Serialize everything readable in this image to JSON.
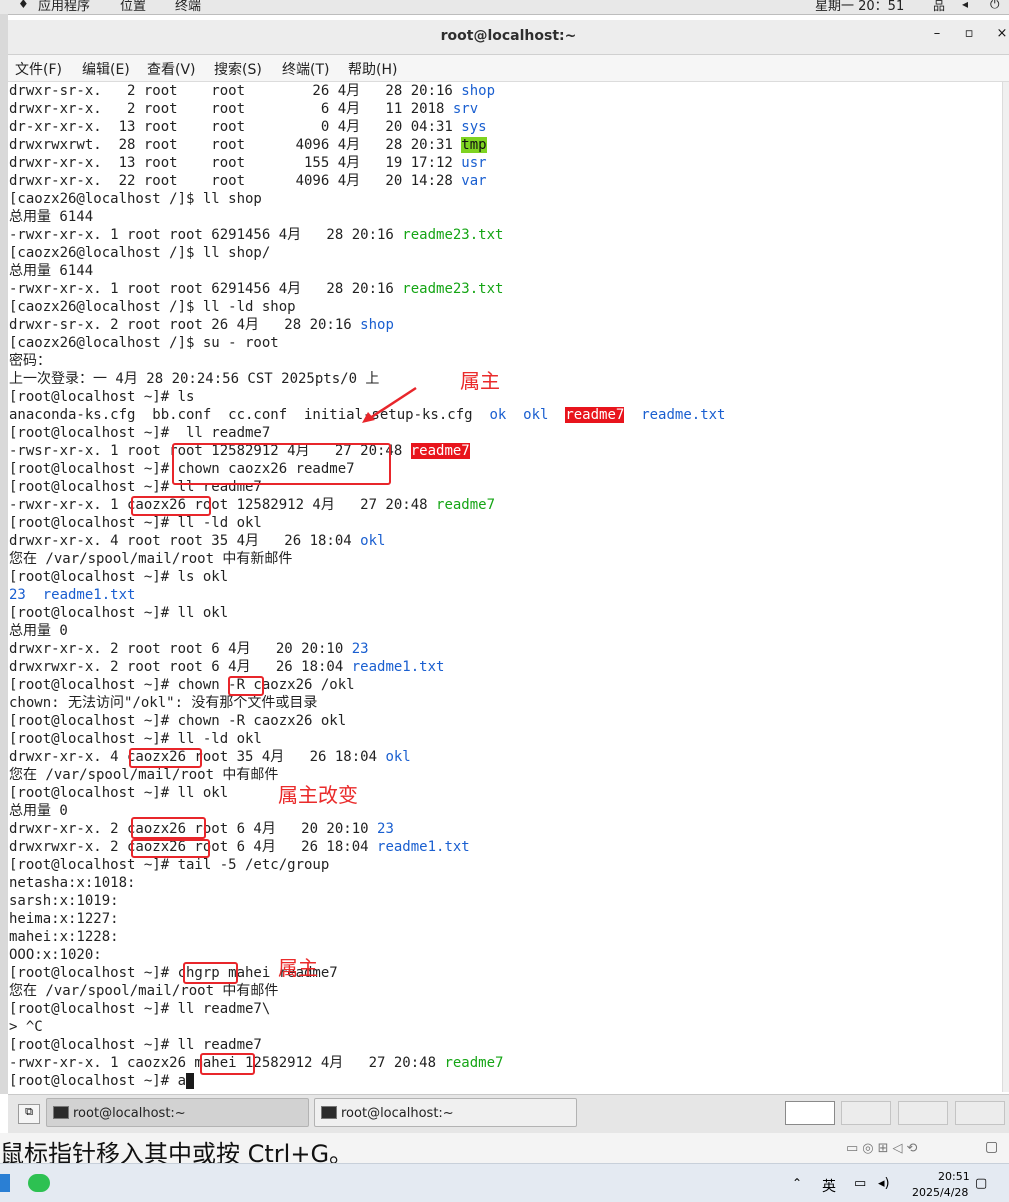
{
  "top_bar": {
    "apps": "应用程序",
    "places": "位置",
    "terminal": "终端",
    "clock": "星期一 20：51"
  },
  "window": {
    "title": "root@localhost:~",
    "minimize": "–",
    "maximize": "▫",
    "close": "×"
  },
  "menu": [
    "文件(F)",
    "编辑(E)",
    "查看(V)",
    "搜索(S)",
    "终端(T)",
    "帮助(H)"
  ],
  "terminal_lines": [
    [
      {
        "t": "drwxr-sr-x.   2 root    root        26 4月   28 20:16 "
      },
      {
        "t": "shop",
        "c": "blue"
      }
    ],
    [
      {
        "t": "drwxr-xr-x.   2 root    root         6 4月   11 2018 "
      },
      {
        "t": "srv",
        "c": "blue"
      }
    ],
    [
      {
        "t": "dr-xr-xr-x.  13 root    root         0 4月   20 04:31 "
      },
      {
        "t": "sys",
        "c": "blue"
      }
    ],
    [
      {
        "t": "drwxrwxrwt.  28 root    root      4096 4月   28 20:31 "
      },
      {
        "t": "tmp",
        "c": "hl-green"
      }
    ],
    [
      {
        "t": "drwxr-xr-x.  13 root    root       155 4月   19 17:12 "
      },
      {
        "t": "usr",
        "c": "blue"
      }
    ],
    [
      {
        "t": "drwxr-xr-x.  22 root    root      4096 4月   20 14:28 "
      },
      {
        "t": "var",
        "c": "blue"
      }
    ],
    [
      {
        "t": "[caozx26@localhost /]$ ll shop"
      }
    ],
    [
      {
        "t": "总用量 6144"
      }
    ],
    [
      {
        "t": "-rwxr-xr-x. 1 root root 6291456 4月   28 20:16 "
      },
      {
        "t": "readme23.txt",
        "c": "green"
      }
    ],
    [
      {
        "t": "[caozx26@localhost /]$ ll shop/"
      }
    ],
    [
      {
        "t": "总用量 6144"
      }
    ],
    [
      {
        "t": "-rwxr-xr-x. 1 root root 6291456 4月   28 20:16 "
      },
      {
        "t": "readme23.txt",
        "c": "green"
      }
    ],
    [
      {
        "t": "[caozx26@localhost /]$ ll -ld shop"
      }
    ],
    [
      {
        "t": "drwxr-sr-x. 2 root root 26 4月   28 20:16 "
      },
      {
        "t": "shop",
        "c": "blue"
      }
    ],
    [
      {
        "t": "[caozx26@localhost /]$ su - root"
      }
    ],
    [
      {
        "t": "密码："
      }
    ],
    [
      {
        "t": "上一次登录：一 4月 28 20:24:56 CST 2025pts/0 上"
      }
    ],
    [
      {
        "t": "[root@localhost ~]# ls"
      }
    ],
    [
      {
        "t": "anaconda-ks.cfg  bb.conf  cc.conf  initial-setup-ks.cfg  "
      },
      {
        "t": "ok",
        "c": "blue"
      },
      {
        "t": "  "
      },
      {
        "t": "okl",
        "c": "blue"
      },
      {
        "t": "  "
      },
      {
        "t": "readme7",
        "c": "hl-red"
      },
      {
        "t": "  "
      },
      {
        "t": "readme.txt",
        "c": "blue"
      }
    ],
    [
      {
        "t": "[root@localhost ~]#  ll readme7"
      }
    ],
    [
      {
        "t": "-rwsr-xr-x. 1 root root 12582912 4月   27 20:48 "
      },
      {
        "t": "readme7",
        "c": "hl-red"
      }
    ],
    [
      {
        "t": "[root@localhost ~]# chown caozx26 readme7"
      }
    ],
    [
      {
        "t": "[root@localhost ~]# ll readme7"
      }
    ],
    [
      {
        "t": "-rwxr-xr-x. 1 caozx26 root 12582912 4月   27 20:48 "
      },
      {
        "t": "readme7",
        "c": "green"
      }
    ],
    [
      {
        "t": "[root@localhost ~]# ll -ld okl"
      }
    ],
    [
      {
        "t": "drwxr-xr-x. 4 root root 35 4月   26 18:04 "
      },
      {
        "t": "okl",
        "c": "blue"
      }
    ],
    [
      {
        "t": "您在 /var/spool/mail/root 中有新邮件"
      }
    ],
    [
      {
        "t": "[root@localhost ~]# ls okl"
      }
    ],
    [
      {
        "t": "23",
        "c": "blue"
      },
      {
        "t": "  "
      },
      {
        "t": "readme1.txt",
        "c": "blue"
      }
    ],
    [
      {
        "t": "[root@localhost ~]# ll okl"
      }
    ],
    [
      {
        "t": "总用量 0"
      }
    ],
    [
      {
        "t": "drwxr-xr-x. 2 root root 6 4月   20 20:10 "
      },
      {
        "t": "23",
        "c": "blue"
      }
    ],
    [
      {
        "t": "drwxrwxr-x. 2 root root 6 4月   26 18:04 "
      },
      {
        "t": "readme1.txt",
        "c": "blue"
      }
    ],
    [
      {
        "t": "[root@localhost ~]# chown -R caozx26 /okl"
      }
    ],
    [
      {
        "t": "chown: 无法访问\"/okl\": 没有那个文件或目录"
      }
    ],
    [
      {
        "t": "[root@localhost ~]# chown -R caozx26 okl"
      }
    ],
    [
      {
        "t": "[root@localhost ~]# ll -ld okl"
      }
    ],
    [
      {
        "t": "drwxr-xr-x. 4 caozx26 root 35 4月   26 18:04 "
      },
      {
        "t": "okl",
        "c": "blue"
      }
    ],
    [
      {
        "t": "您在 /var/spool/mail/root 中有邮件"
      }
    ],
    [
      {
        "t": "[root@localhost ~]# ll okl"
      }
    ],
    [
      {
        "t": "总用量 0"
      }
    ],
    [
      {
        "t": "drwxr-xr-x. 2 caozx26 root 6 4月   20 20:10 "
      },
      {
        "t": "23",
        "c": "blue"
      }
    ],
    [
      {
        "t": "drwxrwxr-x. 2 caozx26 root 6 4月   26 18:04 "
      },
      {
        "t": "readme1.txt",
        "c": "blue"
      }
    ],
    [
      {
        "t": "[root@localhost ~]# tail -5 /etc/group"
      }
    ],
    [
      {
        "t": "netasha:x:1018:"
      }
    ],
    [
      {
        "t": "sarsh:x:1019:"
      }
    ],
    [
      {
        "t": "heima:x:1227:"
      }
    ],
    [
      {
        "t": "mahei:x:1228:"
      }
    ],
    [
      {
        "t": "OOO:x:1020:"
      }
    ],
    [
      {
        "t": "[root@localhost ~]# chgrp mahei readme7"
      }
    ],
    [
      {
        "t": "您在 /var/spool/mail/root 中有邮件"
      }
    ],
    [
      {
        "t": "[root@localhost ~]# ll readme7\\"
      }
    ],
    [
      {
        "t": "> ^C"
      }
    ],
    [
      {
        "t": "[root@localhost ~]# ll readme7"
      }
    ],
    [
      {
        "t": "-rwxr-xr-x. 1 caozx26 mahei 12582912 4月   27 20:48 "
      },
      {
        "t": "readme7",
        "c": "green"
      }
    ],
    [
      {
        "t": "[root@localhost ~]# a"
      },
      {
        "t": "",
        "c": "cursor"
      }
    ]
  ],
  "annotations": {
    "owner_1": "属主",
    "owner_changed": "属主改变",
    "owner_2": "属主"
  },
  "taskbar": {
    "task1": "root@localhost:~",
    "task2": "root@localhost:~"
  },
  "hint": "鼠标指针移入其中或按 Ctrl+G。",
  "tray": {
    "ime": "英",
    "time": "20:51",
    "date": "2025/4/28"
  },
  "colors": {
    "annotation": "#e8262b",
    "dir_blue": "#1a5fd0",
    "exec_green": "#15a515"
  }
}
